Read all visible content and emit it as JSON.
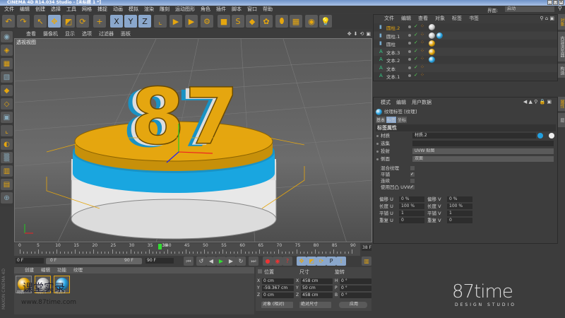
{
  "window": {
    "title": "CINEMA 4D R14.034 Studio - [未标题 1 *]",
    "buttons": [
      "_",
      "□",
      "×"
    ]
  },
  "menu": [
    "文件",
    "编辑",
    "创建",
    "选择",
    "工具",
    "网格",
    "捕捉",
    "动画",
    "模拟",
    "渲染",
    "雕刻",
    "运动图形",
    "角色",
    "插件",
    "脚本",
    "窗口",
    "帮助"
  ],
  "toolbar": {
    "icons": [
      {
        "name": "undo-icon",
        "glyph": "↶"
      },
      {
        "name": "redo-icon",
        "glyph": "↷"
      },
      {
        "name": "live-select-icon",
        "glyph": "↖"
      },
      {
        "name": "move-icon",
        "glyph": "✥"
      },
      {
        "name": "scale-icon",
        "glyph": "◩"
      },
      {
        "name": "rotate-icon",
        "glyph": "⟳"
      },
      {
        "name": "add-icon",
        "glyph": "+"
      },
      {
        "name": "x-axis-icon",
        "glyph": "X"
      },
      {
        "name": "y-axis-icon",
        "glyph": "Y"
      },
      {
        "name": "z-axis-icon",
        "glyph": "Z"
      },
      {
        "name": "coordinate-system-icon",
        "glyph": "⌞"
      },
      {
        "name": "render-view-icon",
        "glyph": "▶"
      },
      {
        "name": "render-picture-icon",
        "glyph": "▶"
      },
      {
        "name": "render-settings-icon",
        "glyph": "⚙"
      },
      {
        "name": "cube-icon",
        "glyph": "■"
      },
      {
        "name": "spline-icon",
        "glyph": "S"
      },
      {
        "name": "nurbs-icon",
        "glyph": "◆"
      },
      {
        "name": "array-icon",
        "glyph": "✿"
      },
      {
        "name": "deformer-icon",
        "glyph": "⬮"
      },
      {
        "name": "floor-icon",
        "glyph": "▦"
      },
      {
        "name": "camera-icon",
        "glyph": "◉"
      },
      {
        "name": "light-icon",
        "glyph": "💡"
      }
    ]
  },
  "interface": {
    "label": "界面:",
    "value": "启动"
  },
  "viewport": {
    "menu": [
      "查看",
      "摄像机",
      "显示",
      "选项",
      "过滤器",
      "面板"
    ],
    "label": "透视视图"
  },
  "timeline": {
    "ticks": [
      0,
      5,
      10,
      15,
      20,
      25,
      30,
      35,
      40,
      45,
      50,
      55,
      60,
      65,
      70,
      75,
      80,
      85,
      90
    ],
    "current": 38,
    "current_label": "38",
    "end_frame": "38 F",
    "min": 0,
    "max": 90
  },
  "transport": {
    "start": "0 F",
    "range_start": "0 F",
    "range_end": "90 F",
    "end": "90 F"
  },
  "materials": {
    "tabs": [
      "创建",
      "编辑",
      "功能",
      "纹理"
    ],
    "items": [
      {
        "name": "材质",
        "color": "#e0a000"
      },
      {
        "name": "材质.1",
        "color": "#bcbcbc"
      },
      {
        "name": "材质.2",
        "color": "#22a0e0"
      }
    ]
  },
  "coords": {
    "headers": [
      "位置",
      "尺寸",
      "旋转"
    ],
    "rows": [
      {
        "axis": "X",
        "pos": "0 cm",
        "saxis": "X",
        "size": "458 cm",
        "raxis": "H",
        "rot": "0 °"
      },
      {
        "axis": "Y",
        "pos": "-59.367 cm",
        "saxis": "Y",
        "size": "50 cm",
        "raxis": "P",
        "rot": "0 °"
      },
      {
        "axis": "Z",
        "pos": "0 cm",
        "saxis": "Z",
        "size": "458 cm",
        "raxis": "B",
        "rot": "0 °"
      }
    ],
    "mode": "对象 (相对)",
    "size_mode": "绝对尺寸",
    "apply": "应用"
  },
  "objects": {
    "menu": [
      "文件",
      "编辑",
      "查看",
      "对象",
      "标签",
      "书签"
    ],
    "rows": [
      {
        "name": "圆柱.2",
        "type": "cylinder",
        "selected": true,
        "tags": [
          "#c8c8c8"
        ]
      },
      {
        "name": "圆柱.1",
        "type": "cylinder",
        "tags": [
          "#c8c8c8",
          "#22a0e0"
        ]
      },
      {
        "name": "圆柱",
        "type": "cylinder",
        "tags": [
          "#e0a000"
        ]
      },
      {
        "name": "文本.3",
        "type": "text",
        "tags": [
          "#e0a000"
        ]
      },
      {
        "name": "文本.2",
        "type": "text",
        "tags": [
          "#22a0e0"
        ]
      },
      {
        "name": "文本",
        "type": "text",
        "tags": []
      },
      {
        "name": "文本.1",
        "type": "text",
        "tags": []
      }
    ]
  },
  "attributes": {
    "menu": [
      "模式",
      "编辑",
      "用户数据"
    ],
    "title": "纹理标签 [纹理]",
    "tabs": [
      "基本",
      "标签",
      "坐标"
    ],
    "section": "标签属性",
    "material_label": "材质",
    "material_value": "材质.2",
    "selection_label": "选集",
    "projection_label": "投射",
    "projection_value": "UVW 贴图",
    "side_label": "侧面",
    "side_value": "双面",
    "checks": [
      {
        "label": "混合纹理",
        "checked": false
      },
      {
        "label": "平铺",
        "checked": true
      },
      {
        "label": "连续",
        "checked": false
      },
      {
        "label": "使用凹凸 UVW",
        "checked": true
      }
    ],
    "uv": [
      {
        "label": "偏移 U",
        "value": "0 %",
        "label2": "偏移 V",
        "value2": "0 %"
      },
      {
        "label": "长度 U",
        "value": "100 %",
        "label2": "长度 V",
        "value2": "100 %"
      },
      {
        "label": "平铺 U",
        "value": "1",
        "label2": "平铺 V",
        "value2": "1"
      },
      {
        "label": "重复 U",
        "value": "0",
        "label2": "重复 V",
        "value2": "0"
      }
    ]
  },
  "side_tabs": [
    "对象",
    "内容浏览器",
    "构造",
    "属性",
    "层"
  ],
  "watermark": {
    "brand": "87time",
    "sub": "DESIGN STUDIO",
    "site": "www.87time.com",
    "cn": "课堂实录",
    "logo": "MAXON CINEMA 4D"
  },
  "colors": {
    "accent": "#e0a000",
    "blue": "#22a0e0",
    "select": "#8aa7cc"
  }
}
